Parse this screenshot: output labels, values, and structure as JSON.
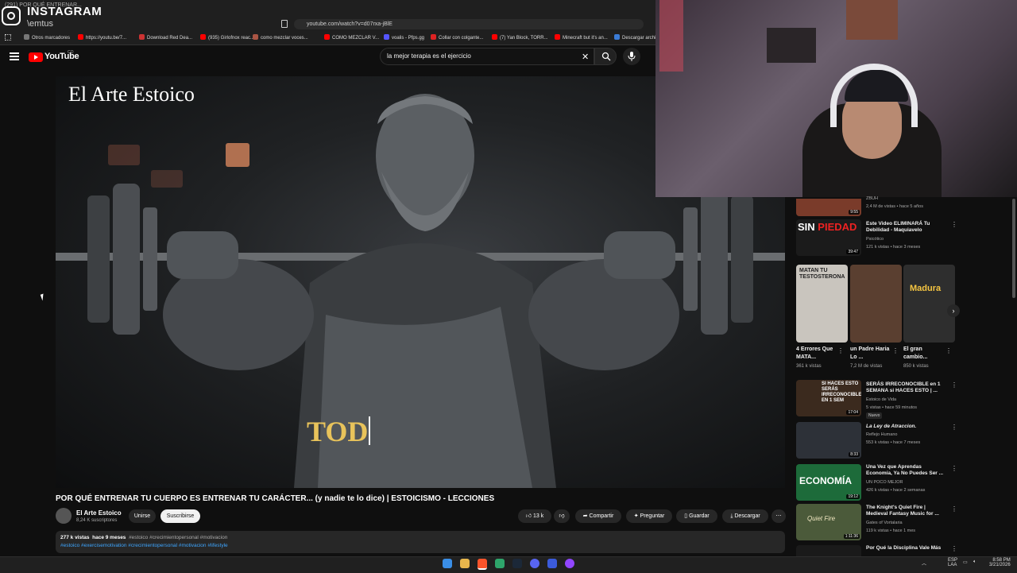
{
  "browser": {
    "tab_title": "(291) POR QUÉ ENTRENAR...",
    "url": "youtube.com/watch?v=d07rxa-jBlE",
    "bookmarks": [
      "Otros marcadores",
      "https://youtu.be/7...",
      "Download Red Dea...",
      "(935) Girlofnox reac...",
      "como mezclar voces...",
      "COMO MEZCLAR V...",
      "voalis - Pfps.gg",
      "Collar con colgante...",
      "(7) Yan Block, TORR...",
      "Minecraft but it's an...",
      "Descargar archi..."
    ]
  },
  "instagram_overlay": {
    "label": "INSTAGRAM",
    "username": "\\emtus"
  },
  "youtube": {
    "logo": "YouTube",
    "country": "CO",
    "search_value": "la mejor terapia es el ejercicio"
  },
  "video": {
    "overlay_title": "El Arte Estoico",
    "overlay_word": "TOD",
    "title": "POR QUÉ ENTRENAR TU CUERPO ES ENTRENAR TU CARÁCTER... (y nadie te lo dice) | ESTOICISMO - LECCIONES",
    "channel": "El Arte Estoico",
    "subscribers": "8,24 K suscriptores",
    "join_label": "Unirse",
    "subscribe_label": "Suscribirse",
    "likes": "13 k",
    "share_label": "Compartir",
    "ask_label": "Preguntar",
    "save_label": "Guardar",
    "download_label": "Descargar",
    "views": "277 k vistas",
    "age": "hace 9 meses",
    "tags_inline": "#estoico #crecimientopersonal #motivacion",
    "tags_line2": "#estoico #exercisemotivation #crecimientopersonal #motivacion #lifestyle"
  },
  "sidebar": {
    "top_partial": {
      "channel": "ZBUH",
      "meta": "2,4 M de vistas • hace 5 años",
      "duration": "9:55"
    },
    "items_top": [
      {
        "title": "Este Video ELIMINARÁ Tu Debilidad - Maquiavelo",
        "channel": "Psicótico",
        "meta": "121 k vistas • hace 3 meses",
        "duration": "39:47"
      }
    ],
    "shorts": [
      {
        "title": "4 Errores Que MATA...",
        "views": "361 k vistas",
        "thumb_text": "MATAN TU TESTOSTERONA"
      },
      {
        "title": "un Padre Haria Lo ...",
        "views": "7,2 M de vistas",
        "thumb_text": ""
      },
      {
        "title": "El gran cambio...",
        "views": "850 k vistas",
        "thumb_text": "Madura"
      }
    ],
    "items": [
      {
        "title": "SERÁS IRRECONOCIBLE en 1 SEMANA si HACES ESTO | ...",
        "channel": "Estoico de Vida",
        "meta": "5 vistas • hace 59 minutos",
        "badge": "Nuevo",
        "duration": "17:04",
        "thumb_text": "SI HACES ESTO SERÁS IRRECONOCIBLE EN 1 SEM"
      },
      {
        "title": "La Ley de Atraccion.",
        "channel": "Reflejo Humano",
        "meta": "553 k vistas • hace 7 meses",
        "badge": "",
        "duration": "8:33",
        "thumb_text": ""
      },
      {
        "title": "Una Vez que Aprendas Economía, Ya No Puedes Ser ...",
        "channel": "UN POCO MEJOR",
        "meta": "426 k vistas • hace 2 semanas",
        "badge": "",
        "duration": "19:12",
        "thumb_text": "ECONOMÍA"
      },
      {
        "title": "The Knight's Quiet Fire | Medieval Fantasy Music for ...",
        "channel": "Gates of Vortalaria",
        "meta": "119 k vistas • hace 1 mes",
        "badge": "",
        "duration": "1:11:36",
        "thumb_text": "Quiet Fire"
      },
      {
        "title": "Por Qué la Disciplina Vale Más",
        "channel": "",
        "meta": "",
        "badge": "",
        "duration": "",
        "thumb_text": ""
      }
    ]
  },
  "taskbar": {
    "lang": "ESP",
    "lang2": "LAA",
    "time": "8:58 PM",
    "date": "3/21/2026"
  },
  "colors": {
    "youtube_red": "#ff0000",
    "link_blue": "#3ea6ff",
    "overlay_gold": "#e8c35b"
  }
}
